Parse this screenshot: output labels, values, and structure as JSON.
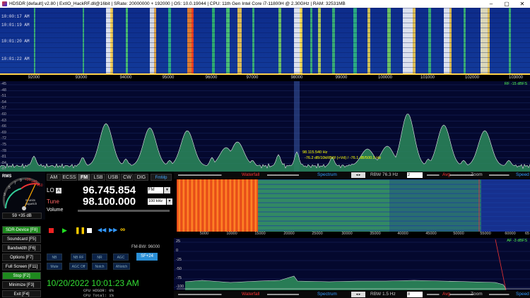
{
  "window": {
    "title": "HDSDR  [default]  v2.80  |  ExtIO_HackRF.dll@16bit  |  SRate: 20000000 + 192000  |  OS: 10.0.19044  |  CPU: 11th Gen Intel Core i7-11800H @ 2.30GHz  |  RAM: 32531MB"
  },
  "top_waterfall": {
    "timestamps": [
      "10:00:17 AM",
      "10:01:19 AM",
      "10:01:20 AM",
      "10:01:22 AM"
    ]
  },
  "top_axis": {
    "ticks": [
      "92000",
      "93000",
      "94000",
      "95000",
      "96000",
      "97000",
      "98000",
      "99000",
      "100000",
      "101000",
      "102000",
      "103000"
    ]
  },
  "spectrum": {
    "y_labels": [
      "-45",
      "-48",
      "-51",
      "-54",
      "-57",
      "-60",
      "-63",
      "-66",
      "-69",
      "-72",
      "-75",
      "-78",
      "-81",
      "-84",
      "-87"
    ],
    "rf_label": "RF -15 dBFS",
    "cursor_freq": "98.115.540 Hz",
    "cursor_info": "-76.2 dB/10kRBW  (+Vd) / -76.1 dB/500.0 Hz"
  },
  "colors": {
    "spectrum_fill": "#2c8a5a",
    "spectrum_line": "#e8e8e8",
    "mode_active": "#444444",
    "green_button": "#1e8a1e"
  },
  "smeter": {
    "rms": "RMS",
    "scale": [
      "3",
      "5",
      "7",
      "9",
      "+20",
      "+40",
      "+60"
    ],
    "caption": "S-units\nSquelch",
    "value": "59 +35 dB"
  },
  "modes": [
    "AM",
    "ECSS",
    "FM",
    "LSB",
    "USB",
    "CW",
    "DIG"
  ],
  "fmmp": "FmMp",
  "lo": {
    "label": "LO",
    "tag": "A",
    "value": "96.745.854",
    "mode": "FM"
  },
  "tune": {
    "label": "Tune",
    "value": "98.100.000",
    "step": "100 kHz"
  },
  "volume": {
    "label": "Volume"
  },
  "nav": [
    {
      "label": "SDR-Device  [F8]"
    },
    {
      "label": "Soundcard  [F5]"
    },
    {
      "label": "Bandwidth  [F6]"
    },
    {
      "label": "Options  [F7]"
    },
    {
      "label": "Full Screen  [F11]"
    },
    {
      "label": "Stop  [F2]"
    },
    {
      "label": "Minimize  [F3]"
    },
    {
      "label": "Exit  [F4]"
    }
  ],
  "transport": [
    "record",
    "play",
    "pause",
    "stop",
    "rewind",
    "forward",
    "loop"
  ],
  "fm_bw": "FM-BW: 96000",
  "dsp": {
    "row1": [
      "NB",
      "NB RF",
      "NR",
      "AGC"
    ],
    "row2": [
      "Mute",
      "AGC Off",
      "Notch",
      "ANotch"
    ],
    "stereo": "SF+24"
  },
  "datetime": "10/20/2022 10:01:23 AM",
  "cpu": [
    "CPU HDSDR:  0%",
    "CPU Total:  1%"
  ],
  "bars": {
    "waterfall1": {
      "waterfall": "Waterfall",
      "spectrum": "Spectrum",
      "rbw": "RBW  76.3 Hz",
      "rbw_val": "2",
      "avg": "Avg",
      "zoom": "Zoom",
      "speed": "Speed"
    },
    "waterfall2": {
      "waterfall": "Waterfall",
      "spectrum": "Spectrum",
      "rbw": "RBW  1.5 Hz",
      "rbw_val": "8",
      "avg": "Avg",
      "zoom": "Zoom",
      "speed": "Speed"
    }
  },
  "wf2_axis": [
    "5000",
    "10000",
    "15000",
    "20000",
    "25000",
    "30000",
    "35000",
    "40000",
    "45000",
    "50000",
    "55000",
    "60000",
    "65"
  ],
  "af": {
    "y_labels": [
      "25",
      "0",
      "-25",
      "-50",
      "-75",
      "-100"
    ],
    "label": "AF -3 dBFS"
  }
}
